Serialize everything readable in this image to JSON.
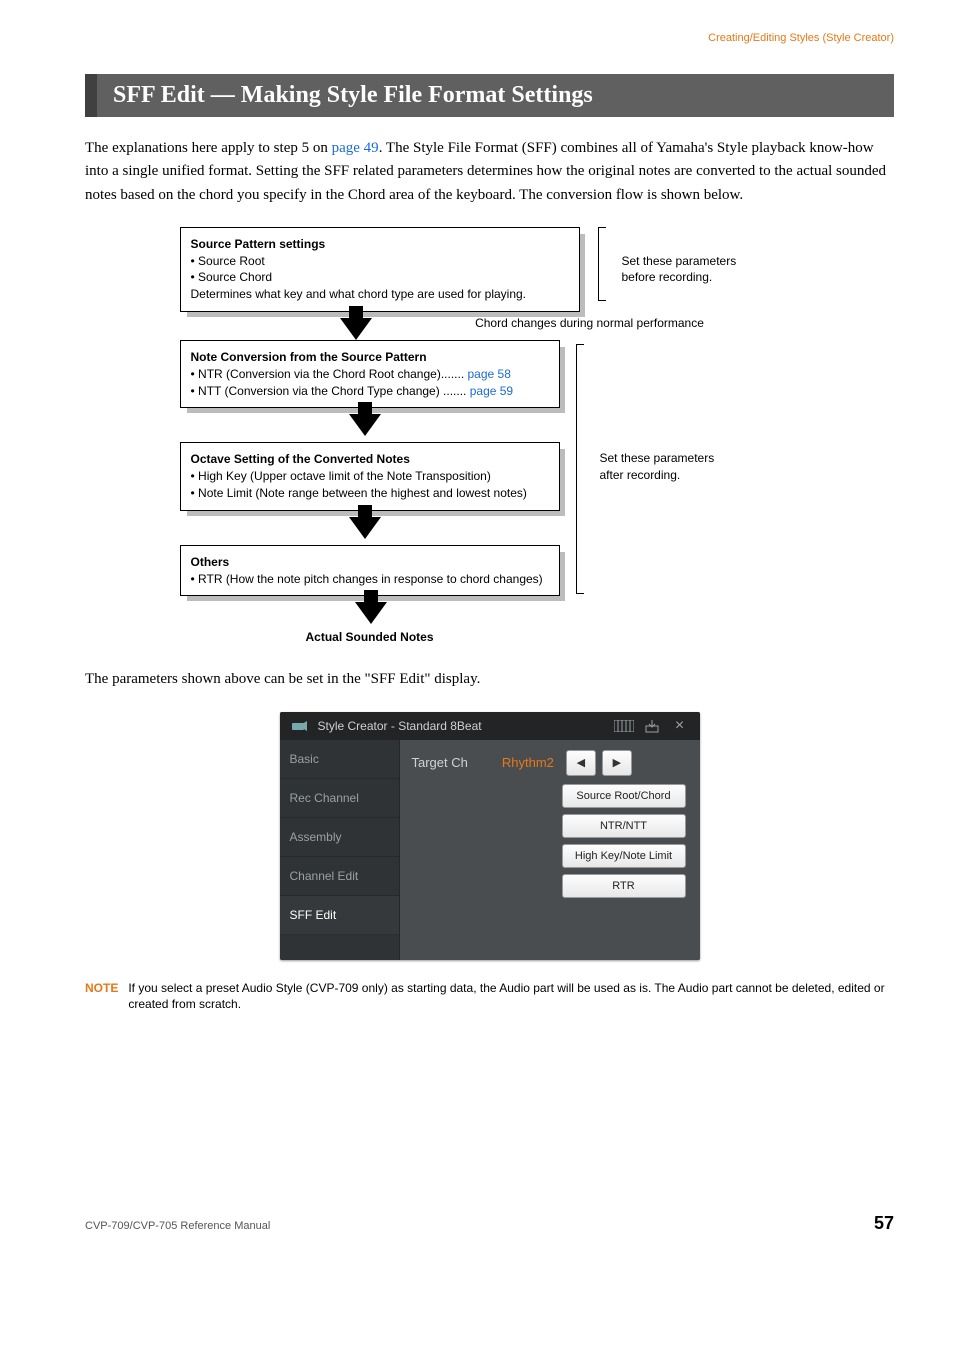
{
  "breadcrumb": "Creating/Editing Styles (Style Creator)",
  "title": "SFF Edit — Making Style File Format Settings",
  "intro_before_link": "The explanations here apply to step 5 on ",
  "intro_link": "page 49",
  "intro_after_link": ". The Style File Format (SFF) combines all of Yamaha's Style playback know-how into a single unified format. Setting the SFF related parameters determines how the original notes are converted to the actual sounded notes based on the chord you specify in the Chord area of the keyboard. The conversion flow is shown below.",
  "diagram": {
    "box1": {
      "title": "Source Pattern settings",
      "line1": "• Source Root",
      "line2": "• Source Chord",
      "line3": "Determines what key and what chord type are used for playing."
    },
    "side1": "Set these parameters before recording.",
    "arrow1_caption": "Chord changes during normal performance",
    "box2": {
      "title": "Note Conversion from the Source Pattern",
      "line1a": "• NTR (Conversion via the Chord Root change)....... ",
      "line1b": "page 58",
      "line2a": "• NTT (Conversion via the Chord Type change) ....... ",
      "line2b": "page 59"
    },
    "box3": {
      "title": "Octave Setting of the Converted Notes",
      "line1": "• High Key (Upper octave limit of the Note Transposition)",
      "line2": "• Note Limit (Note range between the highest and lowest notes)"
    },
    "side2": "Set these parameters after recording.",
    "box4": {
      "title": "Others",
      "line1": "• RTR (How the note pitch changes in response to chord changes)"
    },
    "final": "Actual Sounded Notes"
  },
  "para2": "The parameters shown above can be set in the \"SFF Edit\" display.",
  "ui": {
    "title_prefix": "Style Creator - ",
    "title_name": "Standard 8Beat",
    "close": "×",
    "sidebar": [
      "Basic",
      "Rec Channel",
      "Assembly",
      "Channel Edit",
      "SFF Edit"
    ],
    "target_label": "Target Ch",
    "target_value": "Rhythm2",
    "prev": "◀",
    "next": "▶",
    "chips": [
      "Source Root/Chord",
      "NTR/NTT",
      "High Key/Note Limit",
      "RTR"
    ]
  },
  "note": {
    "label": "NOTE",
    "text": "If you select a preset Audio Style (CVP-709 only) as starting data, the Audio part will be used as is. The Audio part cannot be deleted, edited or created from scratch."
  },
  "footer": {
    "manual": "CVP-709/CVP-705 Reference Manual",
    "page": "57"
  }
}
